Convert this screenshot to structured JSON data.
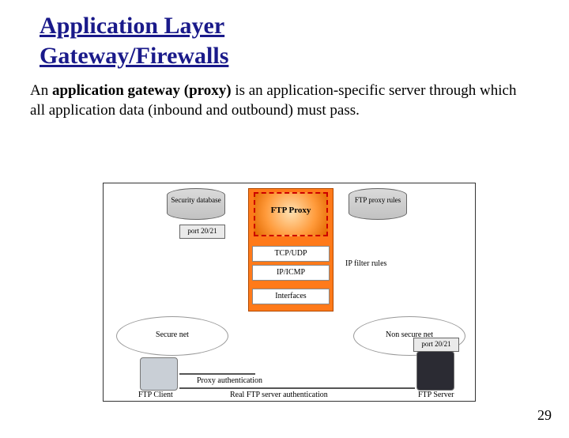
{
  "title_line1": "Application Layer",
  "title_line2": "Gateway/Firewalls",
  "paragraph": "An application gateway (proxy) is an application-specific server through which all application data (inbound and outbound) must pass.",
  "bold_phrase": "application gateway (proxy)",
  "page_number": "29",
  "diagram": {
    "db_left": "Security database",
    "db_right": "FTP proxy rules",
    "port_left": "port 20/21",
    "port_right": "port 20/21",
    "ftp_proxy": "FTP Proxy",
    "tcp_udp": "TCP/UDP",
    "ip_icmp": "IP/ICMP",
    "interfaces": "Interfaces",
    "ip_filter": "IP filter rules",
    "cloud_left": "Secure net",
    "cloud_right": "Non secure net",
    "client_lbl": "FTP Client",
    "server_lbl": "FTP Server",
    "proxy_auth": "Proxy authentication",
    "real_auth": "Real FTP server authentication"
  }
}
